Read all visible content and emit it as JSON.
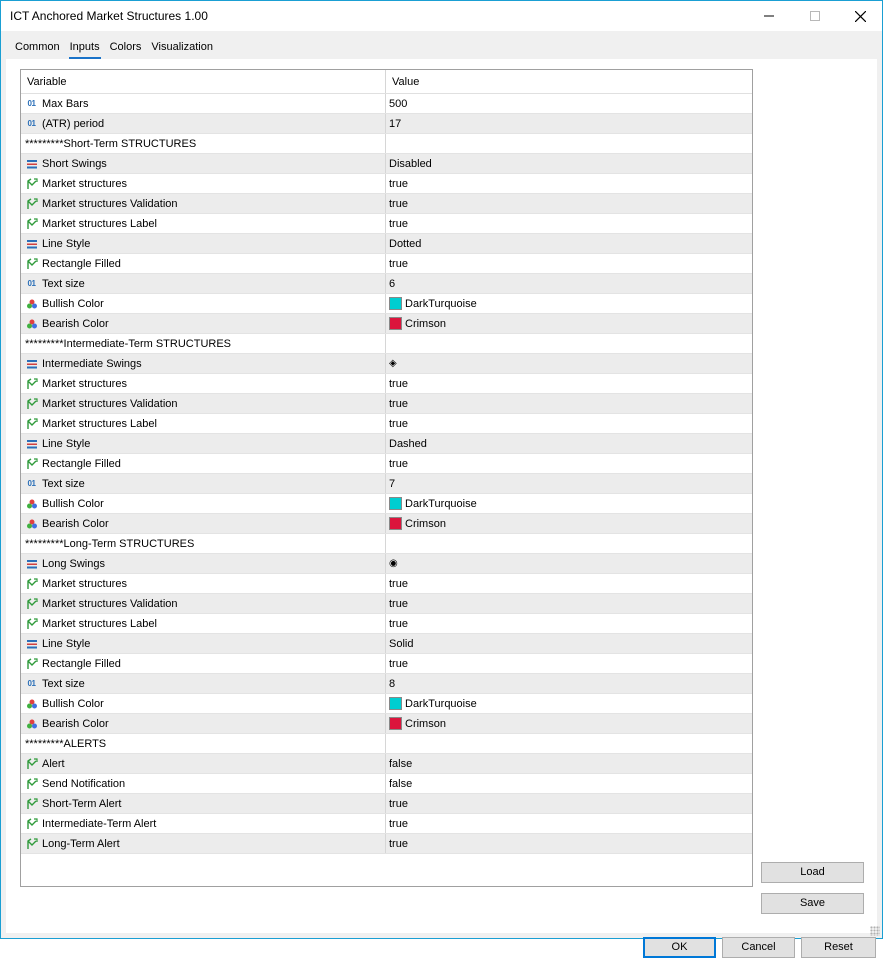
{
  "window": {
    "title": "ICT Anchored Market Structures 1.00"
  },
  "tabs": [
    "Common",
    "Inputs",
    "Colors",
    "Visualization"
  ],
  "grid": {
    "headers": {
      "variable": "Variable",
      "value": "Value"
    },
    "rows": [
      {
        "icon": "int",
        "label": "Max Bars",
        "value": "500"
      },
      {
        "icon": "int",
        "label": "(ATR) period",
        "value": "17"
      },
      {
        "icon": "none",
        "label": "*********Short-Term STRUCTURES",
        "value": ""
      },
      {
        "icon": "enum",
        "label": "Short Swings",
        "value": "Disabled"
      },
      {
        "icon": "bool",
        "label": "Market structures",
        "value": "true"
      },
      {
        "icon": "bool",
        "label": "Market structures Validation",
        "value": "true"
      },
      {
        "icon": "bool",
        "label": "Market structures Label",
        "value": "true"
      },
      {
        "icon": "enum",
        "label": "Line Style",
        "value": "Dotted"
      },
      {
        "icon": "bool",
        "label": "Rectangle Filled",
        "value": "true"
      },
      {
        "icon": "int",
        "label": "Text size",
        "value": "6"
      },
      {
        "icon": "color",
        "label": "Bullish Color",
        "value": "DarkTurquoise",
        "swatch": "#00ced1"
      },
      {
        "icon": "color",
        "label": "Bearish Color",
        "value": "Crimson",
        "swatch": "#dc143c"
      },
      {
        "icon": "none",
        "label": "*********Intermediate-Term STRUCTURES",
        "value": ""
      },
      {
        "icon": "enum",
        "label": "Intermediate Swings",
        "value": "◈"
      },
      {
        "icon": "bool",
        "label": "Market structures",
        "value": "true"
      },
      {
        "icon": "bool",
        "label": "Market structures Validation",
        "value": "true"
      },
      {
        "icon": "bool",
        "label": "Market structures Label",
        "value": "true"
      },
      {
        "icon": "enum",
        "label": "Line Style",
        "value": "Dashed"
      },
      {
        "icon": "bool",
        "label": "Rectangle Filled",
        "value": "true"
      },
      {
        "icon": "int",
        "label": "Text size",
        "value": "7"
      },
      {
        "icon": "color",
        "label": "Bullish Color",
        "value": "DarkTurquoise",
        "swatch": "#00ced1"
      },
      {
        "icon": "color",
        "label": "Bearish Color",
        "value": "Crimson",
        "swatch": "#dc143c"
      },
      {
        "icon": "none",
        "label": "*********Long-Term STRUCTURES",
        "value": ""
      },
      {
        "icon": "enum",
        "label": "Long Swings",
        "value": "◉"
      },
      {
        "icon": "bool",
        "label": "Market structures",
        "value": "true"
      },
      {
        "icon": "bool",
        "label": "Market structures Validation",
        "value": "true"
      },
      {
        "icon": "bool",
        "label": "Market structures Label",
        "value": "true"
      },
      {
        "icon": "enum",
        "label": "Line Style",
        "value": "Solid"
      },
      {
        "icon": "bool",
        "label": "Rectangle Filled",
        "value": "true"
      },
      {
        "icon": "int",
        "label": "Text size",
        "value": "8"
      },
      {
        "icon": "color",
        "label": "Bullish Color",
        "value": "DarkTurquoise",
        "swatch": "#00ced1"
      },
      {
        "icon": "color",
        "label": "Bearish Color",
        "value": "Crimson",
        "swatch": "#dc143c"
      },
      {
        "icon": "none",
        "label": "*********ALERTS",
        "value": ""
      },
      {
        "icon": "bool",
        "label": "Alert",
        "value": "false"
      },
      {
        "icon": "bool",
        "label": "Send Notification",
        "value": "false"
      },
      {
        "icon": "bool",
        "label": "Short-Term Alert",
        "value": "true"
      },
      {
        "icon": "bool",
        "label": "Intermediate-Term Alert",
        "value": "true"
      },
      {
        "icon": "bool",
        "label": "Long-Term Alert",
        "value": "true"
      }
    ]
  },
  "buttons": {
    "load": "Load",
    "save": "Save",
    "ok": "OK",
    "cancel": "Cancel",
    "reset": "Reset"
  },
  "colors": {
    "accent": "#1a73c9",
    "border": "#1a9fd3",
    "bool_icon": "#2e9a3a",
    "int_icon": "#2a6fb8"
  }
}
